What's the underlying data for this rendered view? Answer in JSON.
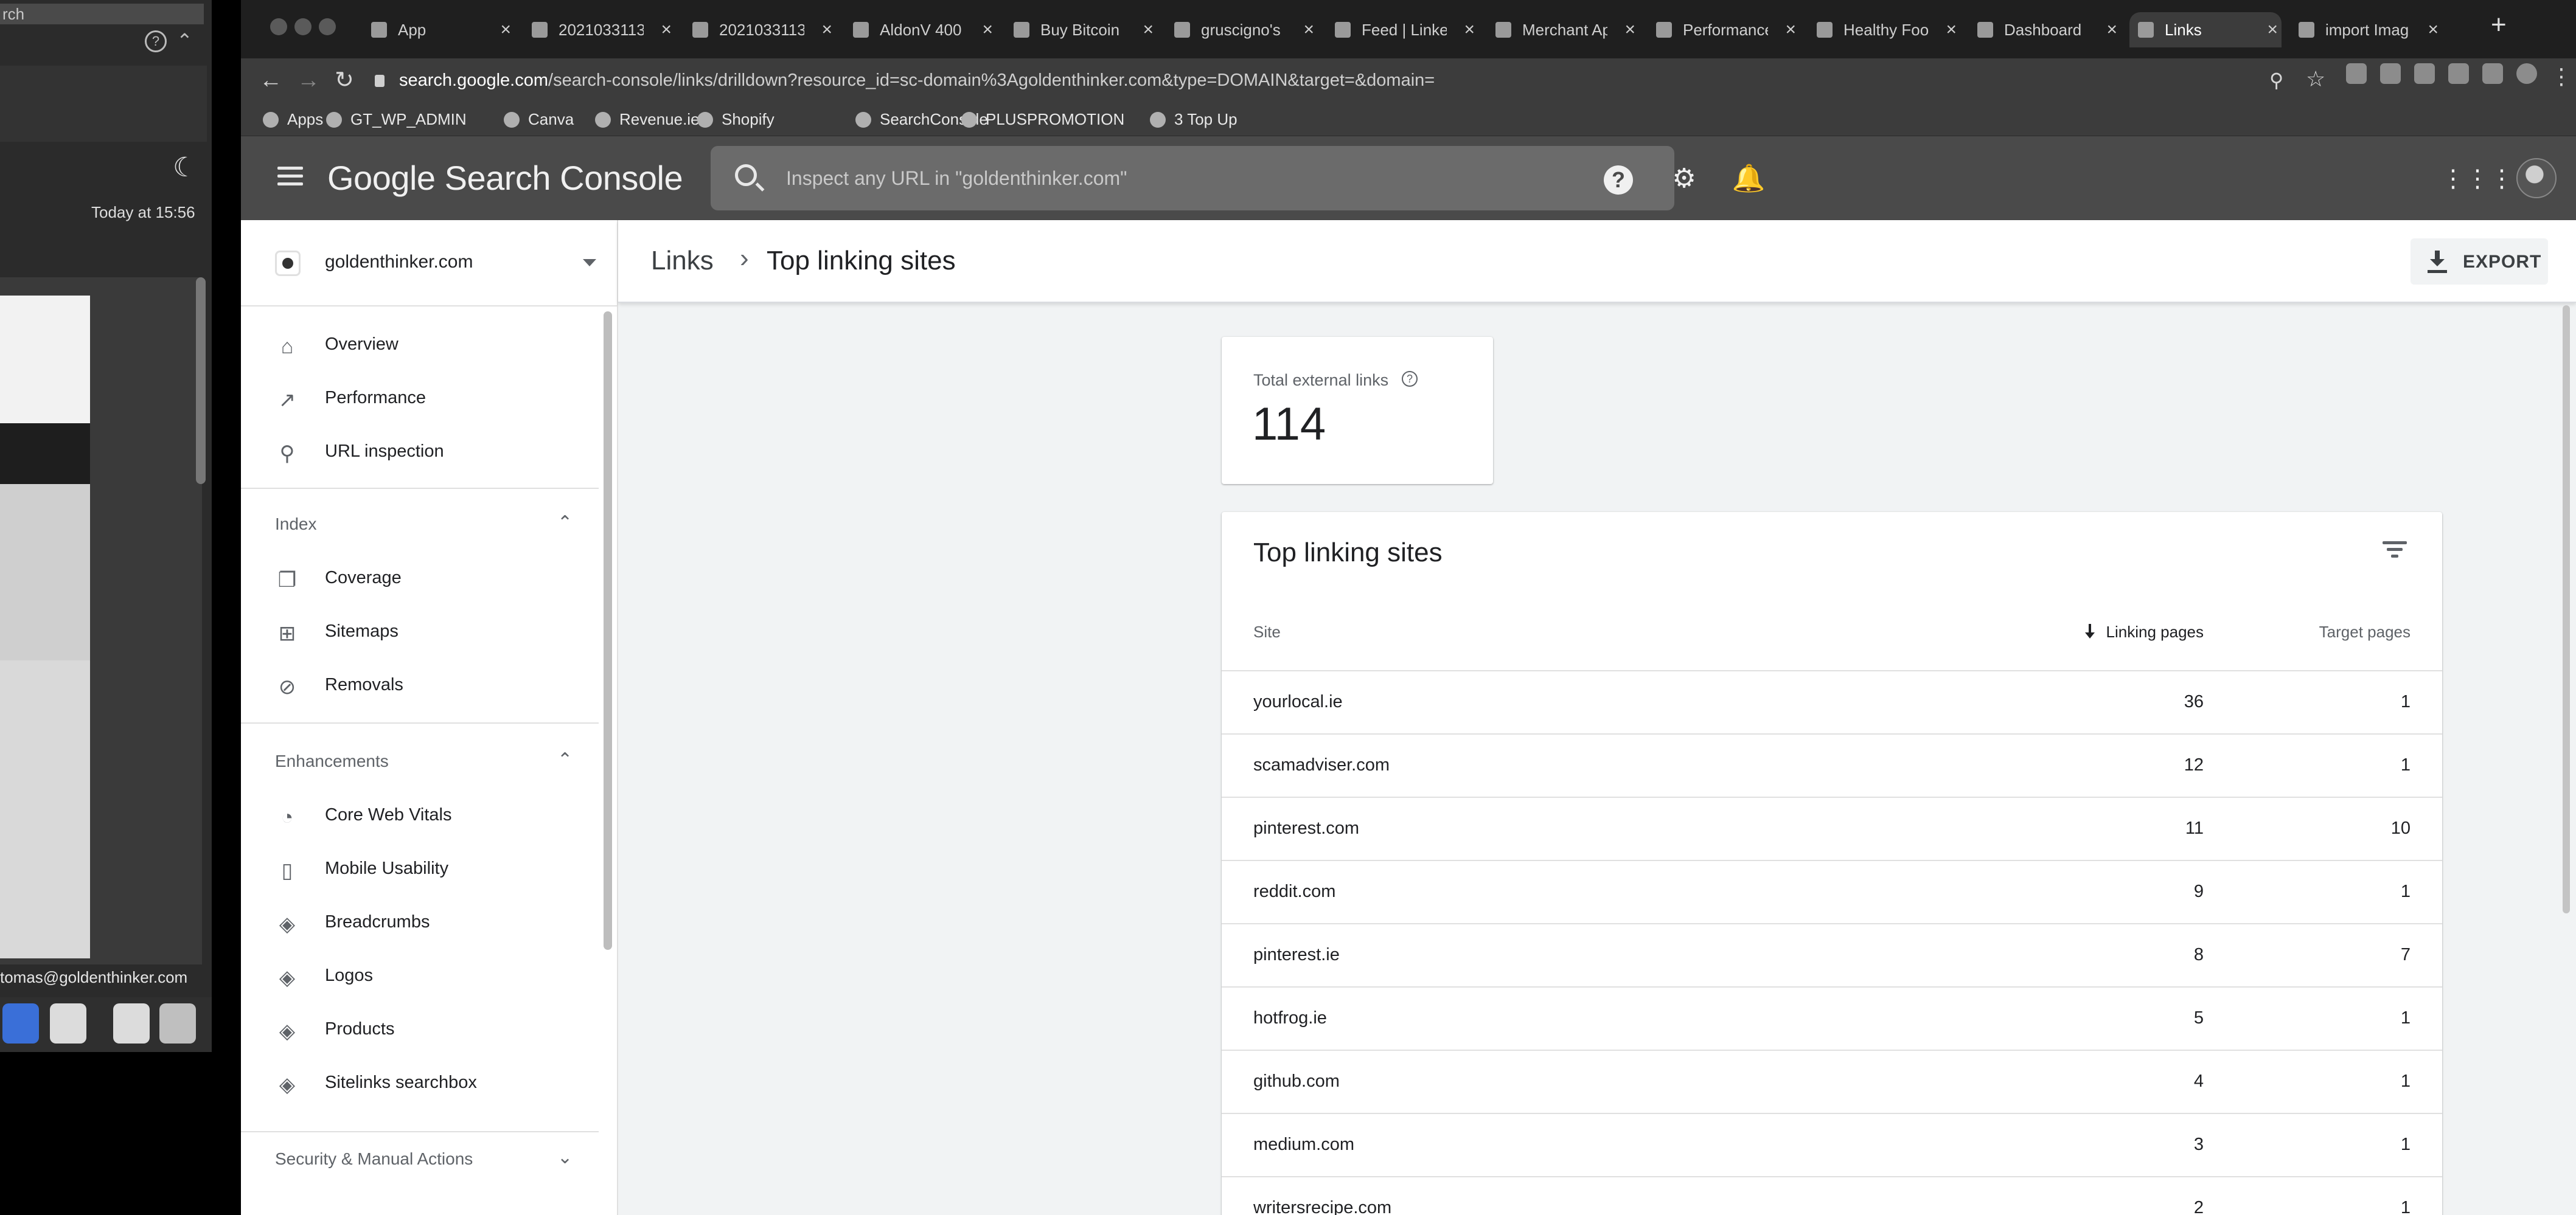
{
  "background_app": {
    "search_text": "rch",
    "timestamp": "Today at 15:56",
    "account_email": "tomas@goldenthinker.com"
  },
  "browser": {
    "tabs": [
      {
        "title": "App",
        "active": false
      },
      {
        "title": "2021033113",
        "active": false
      },
      {
        "title": "2021033113",
        "active": false
      },
      {
        "title": "AldonV 400",
        "active": false
      },
      {
        "title": "Buy Bitcoin",
        "active": false
      },
      {
        "title": "gruscigno's",
        "active": false
      },
      {
        "title": "Feed | Linke",
        "active": false
      },
      {
        "title": "Merchant Ap",
        "active": false
      },
      {
        "title": "Performance",
        "active": false
      },
      {
        "title": "Healthy Foo",
        "active": false
      },
      {
        "title": "Dashboard",
        "active": false
      },
      {
        "title": "Links",
        "active": true
      },
      {
        "title": "import Imag",
        "active": false
      }
    ],
    "new_tab_label": "+",
    "url_host": "search.google.com",
    "url_path": "/search-console/links/drilldown?resource_id=sc-domain%3Agoldenthinker.com&type=DOMAIN&target=&domain=",
    "bookmarks": [
      "Apps",
      "GT_WP_ADMIN",
      "Canva",
      "Revenue.ie",
      "Shopify",
      "SearchConsole",
      "PLUSPROMOTION",
      "3 Top Up"
    ]
  },
  "gsc": {
    "logo": "Google Search Console",
    "search_placeholder": "Inspect any URL in \"goldenthinker.com\""
  },
  "sidebar": {
    "property": "goldenthinker.com",
    "top_items": [
      {
        "label": "Overview",
        "icon": "home-icon"
      },
      {
        "label": "Performance",
        "icon": "trending-up-icon"
      },
      {
        "label": "URL inspection",
        "icon": "search-icon"
      }
    ],
    "index_header": "Index",
    "index_items": [
      {
        "label": "Coverage",
        "icon": "coverage-icon"
      },
      {
        "label": "Sitemaps",
        "icon": "sitemap-icon"
      },
      {
        "label": "Removals",
        "icon": "eye-off-icon"
      }
    ],
    "enhancements_header": "Enhancements",
    "enhancement_items": [
      {
        "label": "Core Web Vitals",
        "icon": "speed-icon"
      },
      {
        "label": "Mobile Usability",
        "icon": "phone-icon"
      },
      {
        "label": "Breadcrumbs",
        "icon": "layers-icon"
      },
      {
        "label": "Logos",
        "icon": "layers-icon"
      },
      {
        "label": "Products",
        "icon": "layers-icon"
      },
      {
        "label": "Sitelinks searchbox",
        "icon": "layers-icon"
      }
    ],
    "security_header": "Security & Manual Actions"
  },
  "page": {
    "breadcrumb_parent": "Links",
    "breadcrumb_separator": "›",
    "title": "Top linking sites",
    "export_label": "EXPORT",
    "total_links_label": "Total external links",
    "total_links_value": "114",
    "table_title": "Top linking sites",
    "columns": {
      "site": "Site",
      "linking": "Linking pages",
      "target": "Target pages"
    },
    "rows": [
      {
        "site": "yourlocal.ie",
        "linking": "36",
        "target": "1"
      },
      {
        "site": "scamadviser.com",
        "linking": "12",
        "target": "1"
      },
      {
        "site": "pinterest.com",
        "linking": "11",
        "target": "10"
      },
      {
        "site": "reddit.com",
        "linking": "9",
        "target": "1"
      },
      {
        "site": "pinterest.ie",
        "linking": "8",
        "target": "7"
      },
      {
        "site": "hotfrog.ie",
        "linking": "5",
        "target": "1"
      },
      {
        "site": "github.com",
        "linking": "4",
        "target": "1"
      },
      {
        "site": "medium.com",
        "linking": "3",
        "target": "1"
      },
      {
        "site": "writersrecipe.com",
        "linking": "2",
        "target": "1"
      }
    ]
  }
}
